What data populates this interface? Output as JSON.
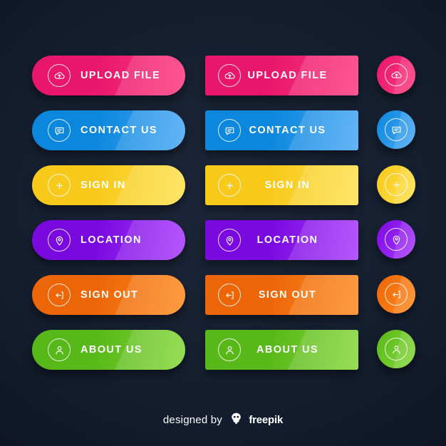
{
  "page": {
    "background_color": "#131c2e",
    "credit_prefix": "designed by",
    "credit_brand": "freepik"
  },
  "buttons": [
    {
      "label": "UPLOAD FILE",
      "icon": "cloud-upload-icon",
      "color_start": "#e8176b",
      "color_end": "#ff3a7f",
      "circle_start": "#e8176b",
      "circle_end": "#ff3a7f"
    },
    {
      "label": "CONTACT US",
      "icon": "chat-bubble-icon",
      "color_start": "#0b87dd",
      "color_end": "#4aa8f5",
      "circle_start": "#0b87dd",
      "circle_end": "#4aa8f5"
    },
    {
      "label": "SIGN IN",
      "icon": "plus-circle-icon",
      "color_start": "#f7c91b",
      "color_end": "#ffe14d",
      "circle_start": "#f7c91b",
      "circle_end": "#ffe14d"
    },
    {
      "label": "LOCATION",
      "icon": "map-pin-icon",
      "color_start": "#7a09e0",
      "color_end": "#a93bff",
      "circle_start": "#7a09e0",
      "circle_end": "#a93bff"
    },
    {
      "label": "SIGN OUT",
      "icon": "logout-arrow-icon",
      "color_start": "#ec6608",
      "color_end": "#ff8a1f",
      "circle_start": "#ec6608",
      "circle_end": "#ff8a1f"
    },
    {
      "label": "ABOUT US",
      "icon": "user-icon",
      "color_start": "#58b81a",
      "color_end": "#86d83a",
      "circle_start": "#58b81a",
      "circle_end": "#86d83a"
    }
  ]
}
